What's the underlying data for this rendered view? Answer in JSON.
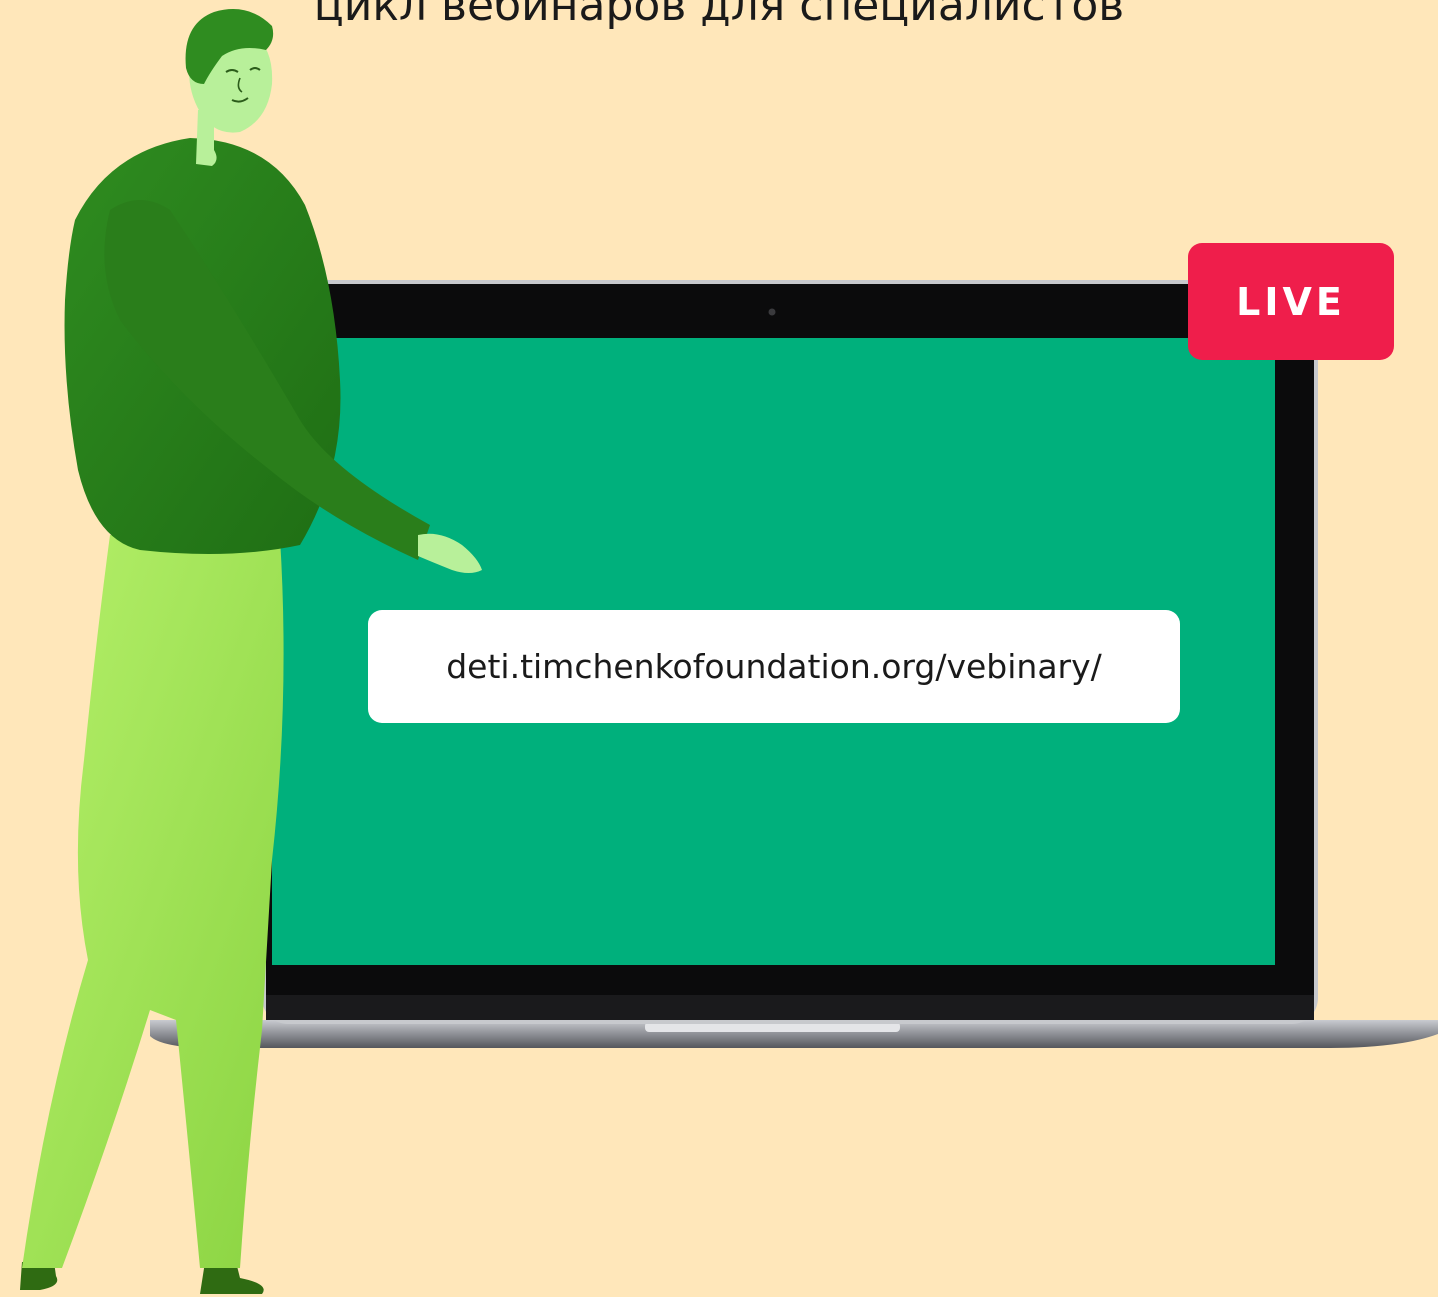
{
  "header": {
    "title": "цикл вебинаров для специалистов"
  },
  "badge": {
    "label": "LIVE"
  },
  "screen": {
    "url": "deti.timchenkofoundation.org/vebinary/"
  },
  "colors": {
    "background": "#FFE7BA",
    "screen": "#00B07C",
    "live_badge": "#EF1E4B",
    "sweater": "#2E8A1E",
    "pants": "#A5E85C",
    "skin": "#B8F09A"
  },
  "icons": {
    "illustration": "presenter-figure",
    "device": "laptop"
  }
}
